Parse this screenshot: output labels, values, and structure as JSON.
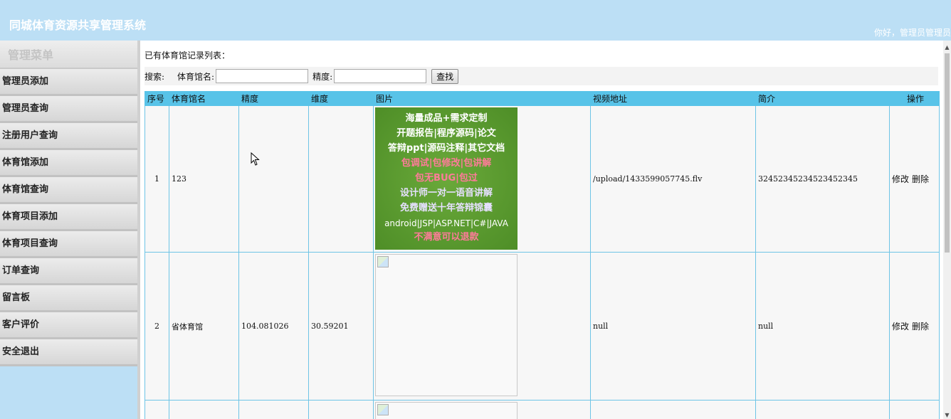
{
  "header": {
    "title": "同城体育资源共享管理系统",
    "welcome": "你好，管理员管理员"
  },
  "sidebar": {
    "heading": "管理菜单",
    "items": [
      {
        "label": "管理员添加"
      },
      {
        "label": "管理员查询"
      },
      {
        "label": "注册用户查询"
      },
      {
        "label": "体育馆添加"
      },
      {
        "label": "体育馆查询"
      },
      {
        "label": "体育项目添加"
      },
      {
        "label": "体育项目查询"
      },
      {
        "label": "订单查询"
      },
      {
        "label": "留言板"
      },
      {
        "label": "客户评价"
      },
      {
        "label": "安全退出"
      }
    ]
  },
  "main": {
    "list_title": "已有体育馆记录列表：",
    "search": {
      "label": "搜索:",
      "name_label": "体育馆名:",
      "name_value": "",
      "precision_label": "精度:",
      "precision_value": "",
      "button": "查找"
    },
    "table": {
      "columns": [
        "序号",
        "体育馆名",
        "精度",
        "维度",
        "图片",
        "视频地址",
        "简介",
        "操作"
      ],
      "rows": [
        {
          "index": "1",
          "name": "123",
          "precision": "",
          "dimension": "",
          "video": "/upload/1433599057745.flv",
          "intro": "32452345234523452345",
          "edit": "修改",
          "delete": "删除"
        },
        {
          "index": "2",
          "name": "省体育馆",
          "precision": "104.081026",
          "dimension": "30.59201",
          "video": "null",
          "intro": "null",
          "edit": "修改",
          "delete": "删除"
        }
      ]
    },
    "promo_lines": [
      "海量成品+需求定制",
      "开题报告|程序源码|论文",
      "答辩ppt|源码注释|其它文档",
      "包调试|包修改|包讲解",
      "包无BUG|包过",
      "设计师一对一语音讲解",
      "免费赠送十年答辩锦囊",
      "android|JSP|ASP.NET|C#|JAVA",
      "不满意可以退款"
    ]
  }
}
